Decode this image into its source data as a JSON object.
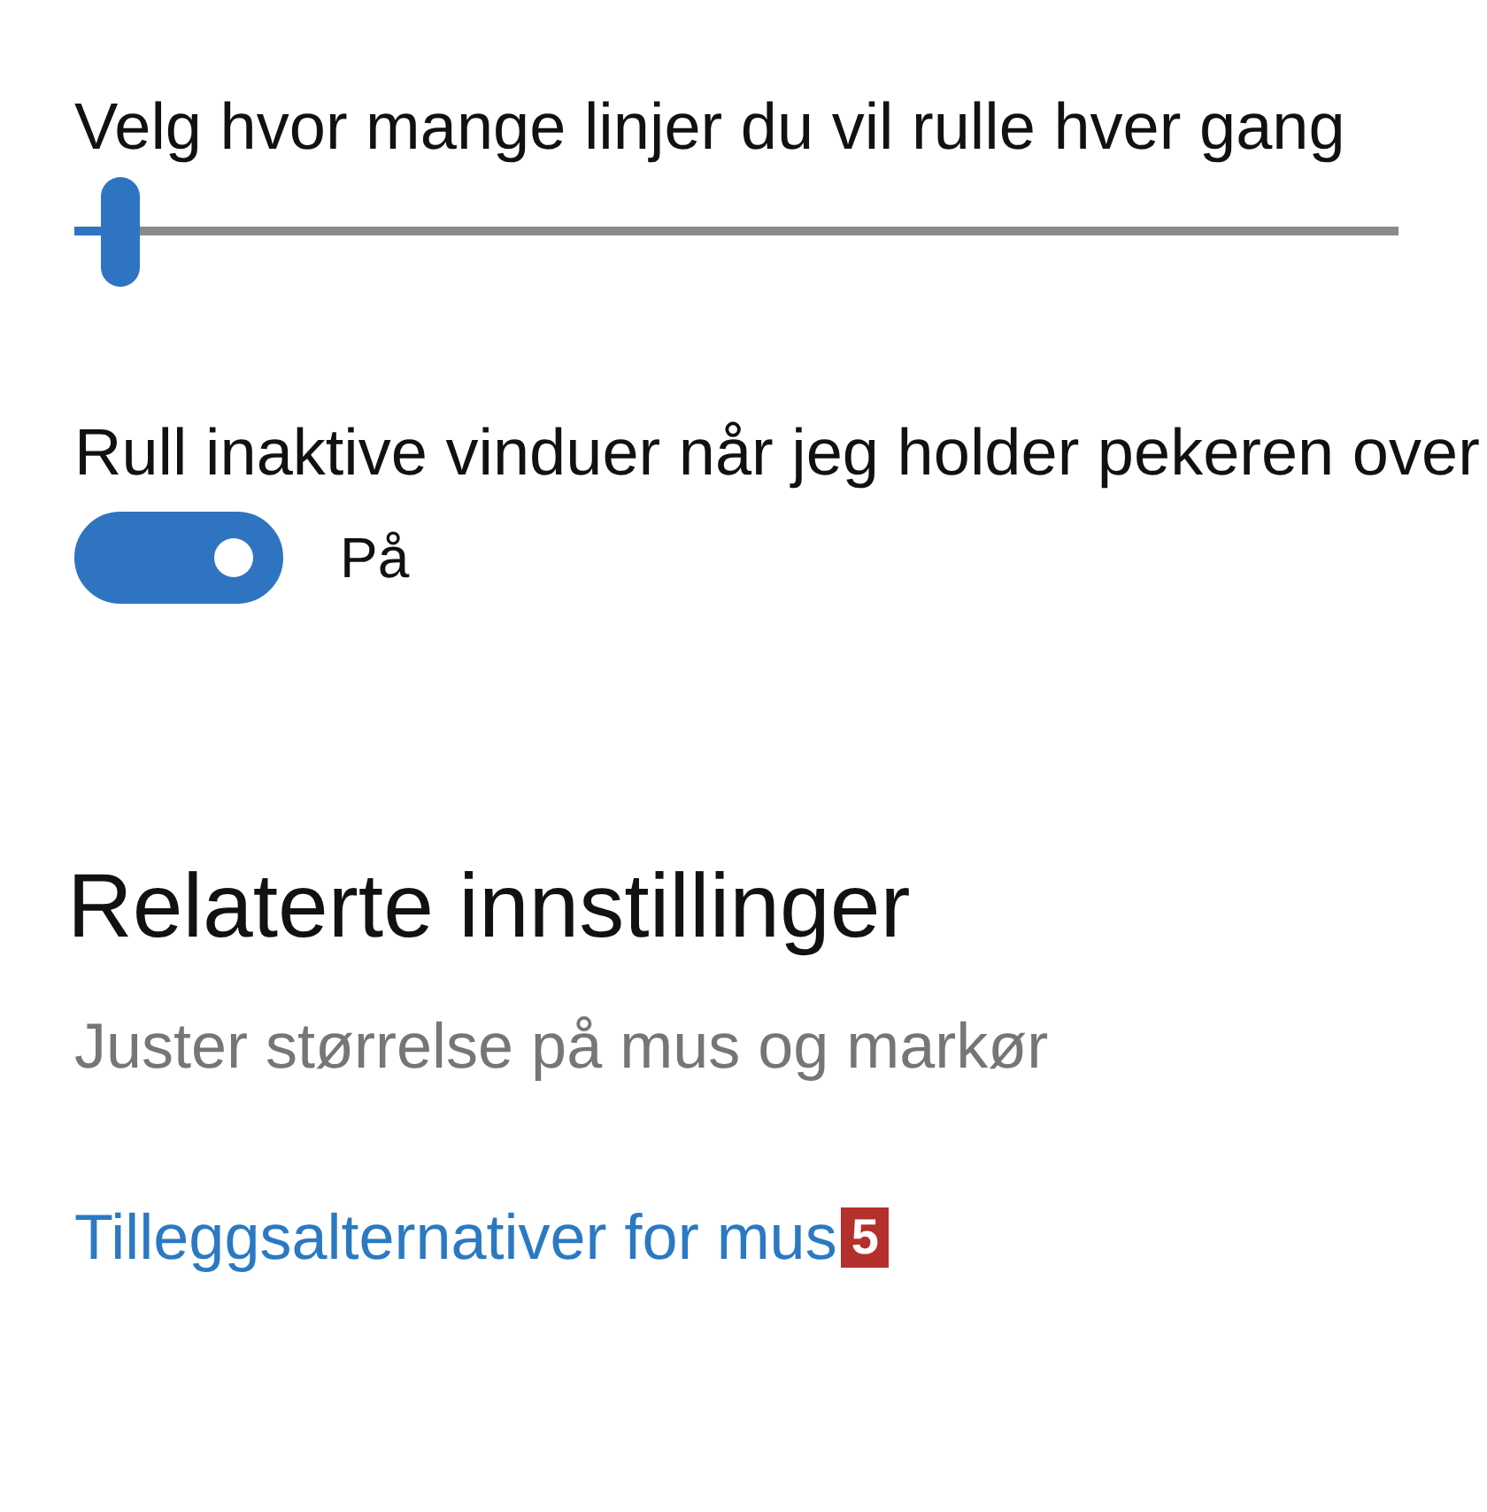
{
  "scroll_lines": {
    "label": "Velg hvor mange linjer du vil rulle hver gang",
    "level": 0.035
  },
  "inactive_scroll": {
    "label": "Rull inaktive vinduer når jeg holder pekeren over",
    "on": true,
    "state_text": "På"
  },
  "related": {
    "heading": "Relaterte innstillinger",
    "links": [
      {
        "text": "Juster størrelse på mus og markør",
        "kind": "muted"
      },
      {
        "text": "Tilleggsalternativer for mus",
        "kind": "accent",
        "callout": "5"
      }
    ]
  }
}
